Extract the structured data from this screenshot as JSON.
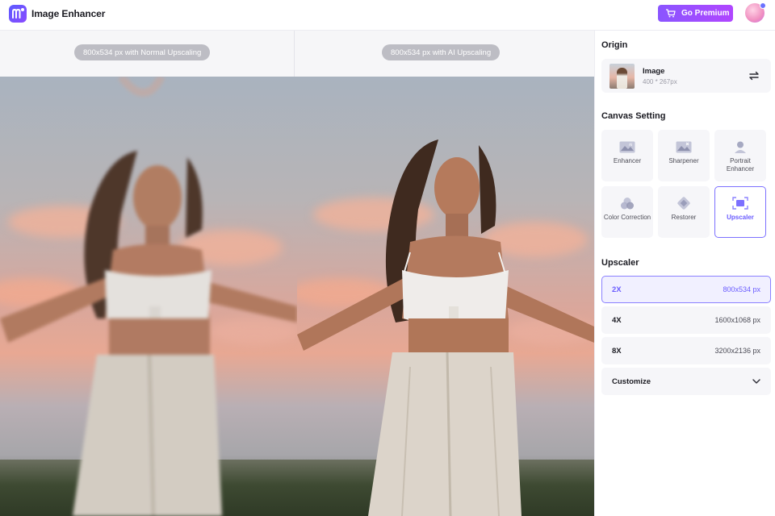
{
  "app": {
    "title": "Image Enhancer",
    "premium_label": "Go Premium"
  },
  "compare": {
    "left_label": "800x534 px with Normal Upscaling",
    "right_label": "800x534 px with AI Upscaling"
  },
  "panel": {
    "origin_title": "Origin",
    "origin_name": "Image",
    "origin_size": "400 * 267px",
    "canvas_title": "Canvas Setting",
    "tools": [
      {
        "label": "Enhancer",
        "icon": "image-ai-icon"
      },
      {
        "label": "Sharpener",
        "icon": "image-sharpen-icon"
      },
      {
        "label": "Portrait Enhancer",
        "icon": "portrait-icon"
      },
      {
        "label": "Color Correction",
        "icon": "color-circles-icon"
      },
      {
        "label": "Restorer",
        "icon": "bandage-icon"
      },
      {
        "label": "Upscaler",
        "icon": "upscale-icon"
      }
    ],
    "active_tool": "Upscaler",
    "upscaler_title": "Upscaler",
    "scales": [
      {
        "factor": "2X",
        "dims": "800x534 px",
        "selected": true
      },
      {
        "factor": "4X",
        "dims": "1600x1068 px",
        "selected": false
      },
      {
        "factor": "8X",
        "dims": "3200x2136 px",
        "selected": false
      }
    ],
    "customize_label": "Customize"
  },
  "colors": {
    "accent": "#6a5cff",
    "premium_start": "#8a55ff",
    "premium_end": "#b046ff"
  }
}
